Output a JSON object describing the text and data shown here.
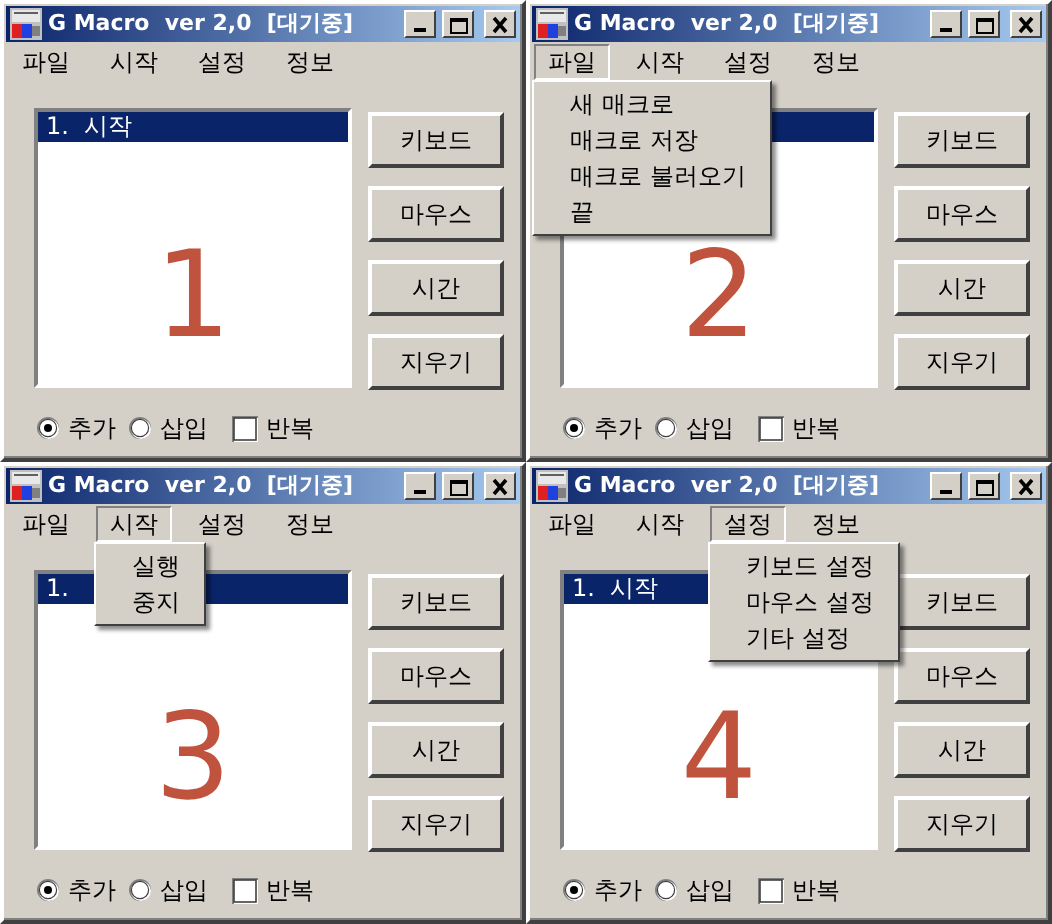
{
  "windows": [
    {
      "title": "G Macro  ver 2,0  [대기중]",
      "menu": [
        {
          "label": "파일",
          "open": false
        },
        {
          "label": "시작",
          "open": false
        },
        {
          "label": "설정",
          "open": false
        },
        {
          "label": "정보",
          "open": false
        }
      ],
      "list": {
        "items": [
          {
            "text": "1.  시작",
            "selected": true
          }
        ]
      },
      "annotation": "1",
      "buttons": [
        "키보드",
        "마우스",
        "시간",
        "지우기"
      ],
      "options": [
        {
          "kind": "radio",
          "label": "추가",
          "checked": true
        },
        {
          "kind": "radio",
          "label": "삽입",
          "checked": false
        },
        {
          "kind": "checkbox",
          "label": "반복",
          "checked": false
        }
      ]
    },
    {
      "title": "G Macro  ver 2,0  [대기중]",
      "menu": [
        {
          "label": "파일",
          "open": true,
          "items": [
            "새 매크로",
            "매크로 저장",
            "매크로 불러오기",
            "끝"
          ]
        },
        {
          "label": "시작",
          "open": false
        },
        {
          "label": "설정",
          "open": false
        },
        {
          "label": "정보",
          "open": false
        }
      ],
      "list": {
        "items": [
          {
            "selected": true
          }
        ]
      },
      "annotation": "2",
      "buttons": [
        "키보드",
        "마우스",
        "시간",
        "지우기"
      ],
      "options": [
        {
          "kind": "radio",
          "label": "추가",
          "checked": true
        },
        {
          "kind": "radio",
          "label": "삽입",
          "checked": false
        },
        {
          "kind": "checkbox",
          "label": "반복",
          "checked": false
        }
      ]
    },
    {
      "title": "G Macro  ver 2,0  [대기중]",
      "menu": [
        {
          "label": "파일",
          "open": false
        },
        {
          "label": "시작",
          "open": true,
          "items": [
            "실행",
            "중지"
          ]
        },
        {
          "label": "설정",
          "open": false
        },
        {
          "label": "정보",
          "open": false
        }
      ],
      "list": {
        "items": [
          {
            "text": "1.",
            "selected": true
          }
        ]
      },
      "annotation": "3",
      "buttons": [
        "키보드",
        "마우스",
        "시간",
        "지우기"
      ],
      "options": [
        {
          "kind": "radio",
          "label": "추가",
          "checked": true
        },
        {
          "kind": "radio",
          "label": "삽입",
          "checked": false
        },
        {
          "kind": "checkbox",
          "label": "반복",
          "checked": false
        }
      ]
    },
    {
      "title": "G Macro  ver 2,0  [대기중]",
      "menu": [
        {
          "label": "파일",
          "open": false
        },
        {
          "label": "시작",
          "open": false
        },
        {
          "label": "설정",
          "open": true,
          "items": [
            "키보드 설정",
            "마우스 설정",
            "기타 설정"
          ]
        },
        {
          "label": "정보",
          "open": false
        }
      ],
      "list": {
        "items": [
          {
            "text": "1.  시작",
            "selected": true
          }
        ]
      },
      "annotation": "4",
      "buttons": [
        "키보드",
        "마우스",
        "시간",
        "지우기"
      ],
      "options": [
        {
          "kind": "radio",
          "label": "추가",
          "checked": true
        },
        {
          "kind": "radio",
          "label": "삽입",
          "checked": false
        },
        {
          "kind": "checkbox",
          "label": "반복",
          "checked": false
        }
      ]
    }
  ]
}
